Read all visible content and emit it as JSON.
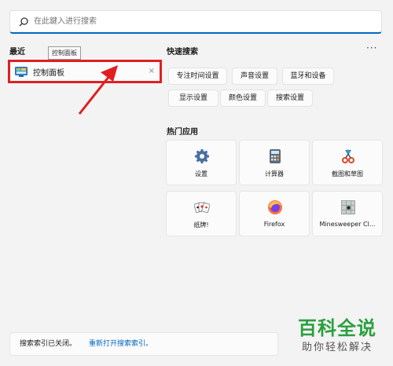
{
  "search": {
    "placeholder": "在此鍵入进行搜索"
  },
  "recent": {
    "title": "最近",
    "items": [
      {
        "label": "控制面板",
        "tooltip": "控制面板",
        "close": "×"
      }
    ]
  },
  "quick_search": {
    "title": "快速搜索",
    "more": "···",
    "items": [
      "专注时间设置",
      "声音设置",
      "蓝牙和设备",
      "显示设置",
      "颜色设置",
      "搜索设置"
    ]
  },
  "top_apps": {
    "title": "热门应用",
    "items": [
      {
        "label": "设置",
        "icon": "gear-icon"
      },
      {
        "label": "计算器",
        "icon": "calculator-icon"
      },
      {
        "label": "截图和草图",
        "icon": "snipping-tool-icon"
      },
      {
        "label": "纸牌!",
        "icon": "cards-icon"
      },
      {
        "label": "Firefox",
        "icon": "firefox-icon"
      },
      {
        "label": "Minesweeper Cl...",
        "icon": "minesweeper-icon"
      }
    ]
  },
  "status": {
    "text": "搜索索引已关闭。",
    "link": "重新打开搜索索引。"
  },
  "watermark": {
    "line1": "百科全说",
    "line2": "助你轻松解决"
  },
  "colors": {
    "accent": "#0067c0",
    "highlight": "#e02020",
    "watermark": "#2a9f3e"
  }
}
